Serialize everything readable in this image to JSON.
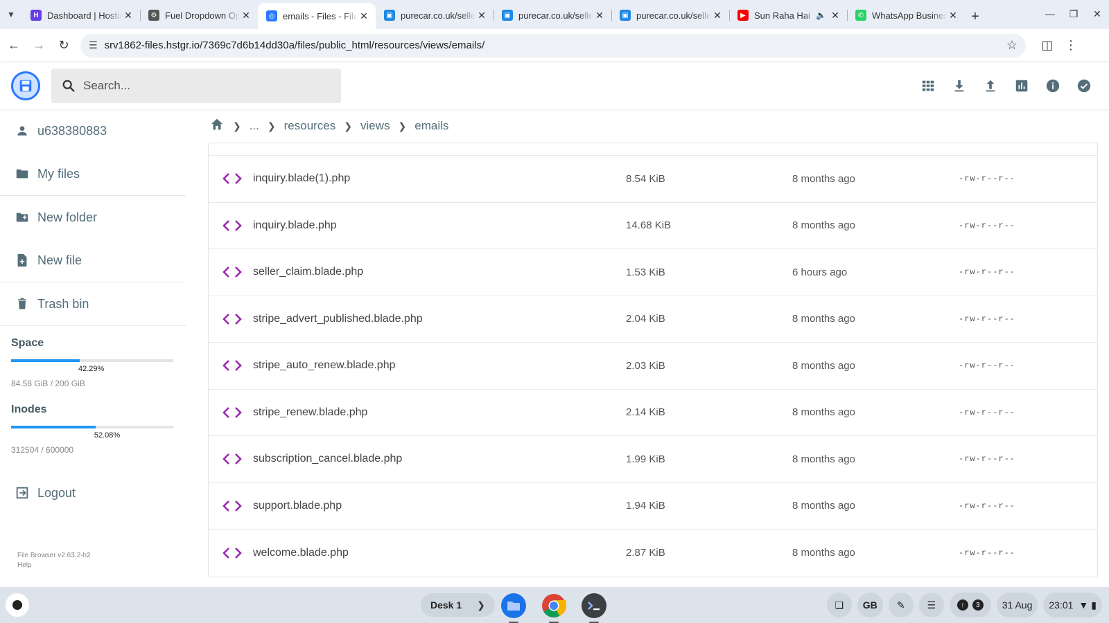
{
  "browser": {
    "tabs": [
      {
        "title": "Dashboard | Hostinger",
        "favicon_color": "#673de6",
        "favicon": "H"
      },
      {
        "title": "Fuel Dropdown Options",
        "favicon_color": "#555555",
        "favicon": "⚙"
      },
      {
        "title": "emails - Files - File Browser",
        "favicon_color": "#2979ff",
        "favicon": "◎",
        "active": true
      },
      {
        "title": "purecar.co.uk/seller",
        "favicon_color": "#1e88e5",
        "favicon": "▣"
      },
      {
        "title": "purecar.co.uk/seller",
        "favicon_color": "#1e88e5",
        "favicon": "▣"
      },
      {
        "title": "purecar.co.uk/seller",
        "favicon_color": "#1e88e5",
        "favicon": "▣"
      },
      {
        "title": "Sun Raha Hai",
        "favicon_color": "#ff0000",
        "favicon": "▶",
        "audio": true
      },
      {
        "title": "WhatsApp Business",
        "favicon_color": "#25d366",
        "favicon": "✆"
      }
    ],
    "url": "srv1862-files.hstgr.io/7369c7d6b14dd30a/files/public_html/resources/views/emails/"
  },
  "app": {
    "search_placeholder": "Search...",
    "accent": "#2979ff",
    "file_icon_color": "#9c27b0"
  },
  "sidebar": {
    "user": "u638380883",
    "items": [
      "My files",
      "New folder",
      "New file",
      "Trash bin"
    ],
    "space": {
      "label": "Space",
      "percent": "42.29%",
      "fraction": 0.4229,
      "detail": "84.58 GiB / 200 GiB"
    },
    "inodes": {
      "label": "Inodes",
      "percent": "52.08%",
      "fraction": 0.5208,
      "detail": "312504 / 600000"
    },
    "logout": "Logout",
    "version": "File Browser v2.63.2-h2",
    "help": "Help"
  },
  "breadcrumb": [
    "...",
    "resources",
    "views",
    "emails"
  ],
  "files": [
    {
      "name": "inquiry.blade(1).php",
      "size": "8.54 KiB",
      "modified": "8 months ago",
      "perm": "-rw-r--r--"
    },
    {
      "name": "inquiry.blade.php",
      "size": "14.68 KiB",
      "modified": "8 months ago",
      "perm": "-rw-r--r--"
    },
    {
      "name": "seller_claim.blade.php",
      "size": "1.53 KiB",
      "modified": "6 hours ago",
      "perm": "-rw-r--r--"
    },
    {
      "name": "stripe_advert_published.blade.php",
      "size": "2.04 KiB",
      "modified": "8 months ago",
      "perm": "-rw-r--r--"
    },
    {
      "name": "stripe_auto_renew.blade.php",
      "size": "2.03 KiB",
      "modified": "8 months ago",
      "perm": "-rw-r--r--"
    },
    {
      "name": "stripe_renew.blade.php",
      "size": "2.14 KiB",
      "modified": "8 months ago",
      "perm": "-rw-r--r--"
    },
    {
      "name": "subscription_cancel.blade.php",
      "size": "1.99 KiB",
      "modified": "8 months ago",
      "perm": "-rw-r--r--"
    },
    {
      "name": "support.blade.php",
      "size": "1.94 KiB",
      "modified": "8 months ago",
      "perm": "-rw-r--r--"
    },
    {
      "name": "welcome.blade.php",
      "size": "2.87 KiB",
      "modified": "8 months ago",
      "perm": "-rw-r--r--"
    }
  ],
  "shelf": {
    "desk": "Desk 1",
    "lang": "GB",
    "notifications": "3",
    "date": "31 Aug",
    "time": "23:01"
  }
}
